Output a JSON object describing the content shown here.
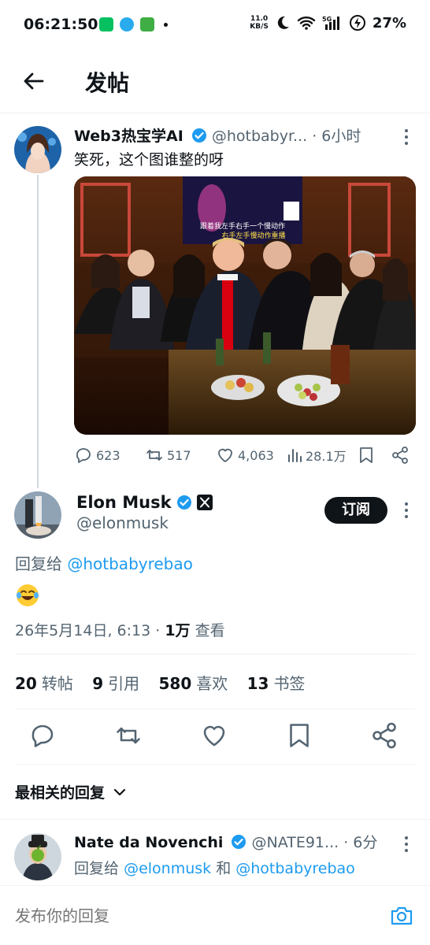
{
  "status_bar": {
    "time": "06:21:50",
    "net_speed_value": "11.0",
    "net_speed_unit": "KB/S",
    "network": "5G",
    "battery": "27%"
  },
  "header": {
    "title": "发帖"
  },
  "tweet1": {
    "name": "Web3热宝学AI",
    "handle": "@hotbabyr...",
    "time": "· 6小时",
    "text": "笑死，这个图谁整的呀",
    "photo_caption_line1": "跟着我左手右手一个慢动作",
    "photo_caption_line2": "右手左手慢动作重播",
    "replies": "623",
    "retweets": "517",
    "likes": "4,063",
    "views": "28.1万"
  },
  "elon": {
    "name": "Elon Musk",
    "handle": "@elonmusk",
    "subscribe_label": "订阅",
    "reply_prefix": "回复给",
    "reply_to": "@hotbabyrebao",
    "date": "26年5月14日, 6:13 · ",
    "views_count": "1万",
    "views_label": " 查看"
  },
  "stats": [
    {
      "count": "20",
      "label": "转帖"
    },
    {
      "count": "9",
      "label": "引用"
    },
    {
      "count": "580",
      "label": "喜欢"
    },
    {
      "count": "13",
      "label": "书签"
    }
  ],
  "relevant_replies_label": "最相关的回复",
  "nate": {
    "name": "Nate da Novenchi",
    "handle": "@NATE91...",
    "time": "· 6分",
    "reply_prefix": "回复给",
    "reply_to_1": "@elonmusk",
    "and": " 和 ",
    "reply_to_2": "@hotbabyrebao"
  },
  "compose": {
    "placeholder": "发布你的回复"
  },
  "colors": {
    "accent": "#1d9bf0",
    "text": "#0f1419",
    "secondary": "#536471"
  }
}
